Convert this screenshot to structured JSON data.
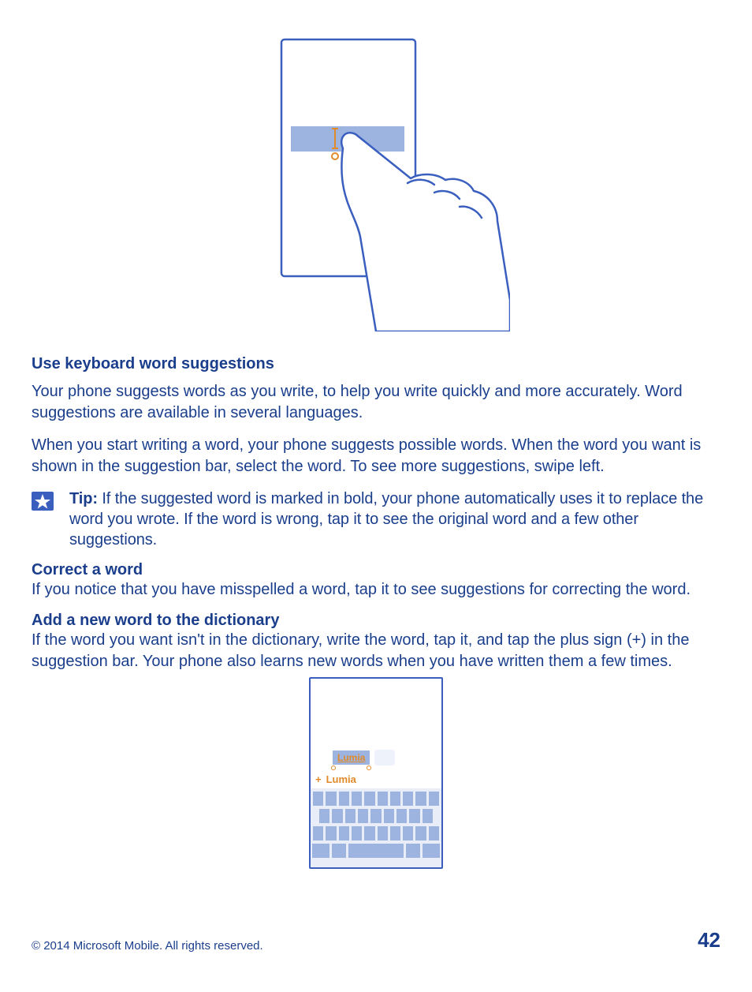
{
  "section1": {
    "heading": "Use keyboard word suggestions",
    "para1": "Your phone suggests words as you write, to help you write quickly and more accurately. Word suggestions are available in several languages.",
    "para2": "When you start writing a word, your phone suggests possible words. When the word you want is shown in the suggestion bar, select the word. To see more suggestions, swipe left."
  },
  "tip": {
    "label": "Tip:",
    "text": " If the suggested word is marked in bold, your phone automatically uses it to replace the word you wrote. If the word is wrong, tap it to see the original word and a few other suggestions."
  },
  "section2": {
    "heading": "Correct a word",
    "para": "If you notice that you have misspelled a word, tap it to see suggestions for correcting the word."
  },
  "section3": {
    "heading": "Add a new word to the dictionary",
    "para": "If the word you want isn't in the dictionary, write the word, tap it, and tap the plus sign (+) in the suggestion bar. Your phone also learns new words when you have written them a few times."
  },
  "fig2": {
    "typed_word": "Lumia",
    "suggestion_plus": "+",
    "suggestion_word": "Lumia"
  },
  "footer": {
    "copyright": "© 2014 Microsoft Mobile. All rights reserved.",
    "page": "42"
  }
}
